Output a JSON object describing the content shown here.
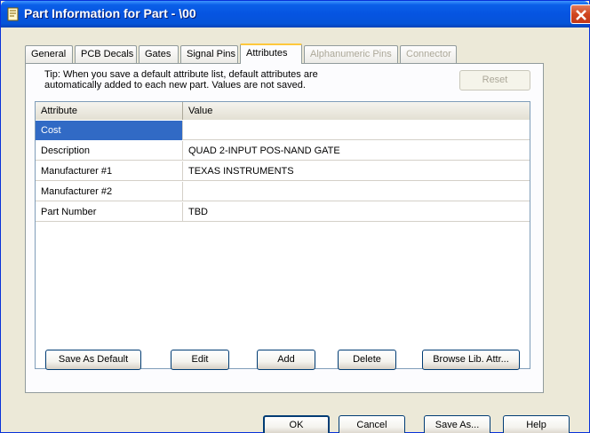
{
  "window": {
    "title": "Part Information for Part - \\00",
    "icon": "part-info-icon",
    "close_icon": "close-icon"
  },
  "tabs": [
    {
      "label": "General",
      "state": "normal"
    },
    {
      "label": "PCB Decals",
      "state": "normal"
    },
    {
      "label": "Gates",
      "state": "normal"
    },
    {
      "label": "Signal Pins",
      "state": "normal"
    },
    {
      "label": "Attributes",
      "state": "active"
    },
    {
      "label": "Alphanumeric Pins",
      "state": "disabled"
    },
    {
      "label": "Connector",
      "state": "disabled"
    }
  ],
  "panel": {
    "tip_line1": "Tip: When you save a default attribute list, default attributes are",
    "tip_line2": "automatically added to each new part. Values are not saved.",
    "reset_label": "Reset"
  },
  "grid": {
    "columns": [
      "Attribute",
      "Value"
    ],
    "rows": [
      {
        "attribute": "Cost",
        "value": "",
        "selected": true
      },
      {
        "attribute": "Description",
        "value": "QUAD 2-INPUT POS-NAND GATE"
      },
      {
        "attribute": "Manufacturer #1",
        "value": "TEXAS INSTRUMENTS"
      },
      {
        "attribute": "Manufacturer #2",
        "value": ""
      },
      {
        "attribute": "Part Number",
        "value": "TBD"
      }
    ]
  },
  "actions": {
    "save_as_default": "Save As Default",
    "edit": "Edit",
    "add": "Add",
    "delete": "Delete",
    "browse": "Browse Lib. Attr..."
  },
  "dialog_buttons": {
    "ok": "OK",
    "cancel": "Cancel",
    "save_as": "Save As...",
    "help": "Help"
  },
  "colors": {
    "title_bar": "#0654e1",
    "selection": "#316ac5",
    "dialog_bg": "#ece9d8",
    "active_tab_accent": "#ffc83c"
  }
}
